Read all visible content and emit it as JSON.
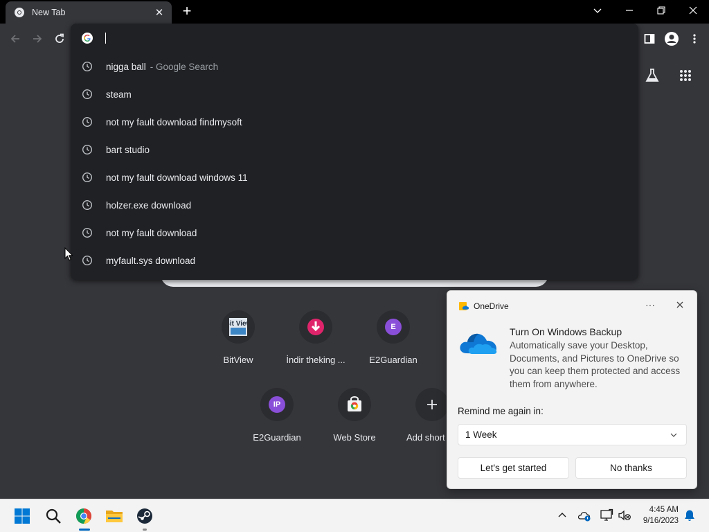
{
  "browser": {
    "tab_title": "New Tab",
    "omnibox_value": "",
    "suggestions": [
      {
        "text": "nigga ball",
        "suffix": "- Google Search"
      },
      {
        "text": "steam",
        "suffix": ""
      },
      {
        "text": "not my fault download findmysoft",
        "suffix": ""
      },
      {
        "text": "bart studio",
        "suffix": ""
      },
      {
        "text": "not my fault download windows 11",
        "suffix": ""
      },
      {
        "text": "holzer.exe download",
        "suffix": ""
      },
      {
        "text": "not my fault download",
        "suffix": ""
      },
      {
        "text": "myfault.sys download",
        "suffix": ""
      }
    ]
  },
  "shortcuts": [
    {
      "label": "BitView",
      "icon": "bitview-logo",
      "icon_text": "Bit View"
    },
    {
      "label": "İndir theking ...",
      "icon": "download-icon"
    },
    {
      "label": "E2Guardian",
      "icon": "letter-avatar",
      "letter": "E"
    },
    {
      "label": "E2Guardian",
      "icon": "letter-avatar",
      "letter": "IP"
    },
    {
      "label": "Web Store",
      "icon": "webstore-icon"
    },
    {
      "label": "Add short",
      "icon": "plus-icon"
    }
  ],
  "onedrive": {
    "app": "OneDrive",
    "title": "Turn On Windows Backup",
    "body": "Automatically save your Desktop, Documents, and Pictures to OneDrive so you can keep them protected and access them from anywhere.",
    "remind_label": "Remind me again in:",
    "remind_value": "1 Week",
    "primary_button": "Let's get started",
    "secondary_button": "No thanks",
    "more": "···"
  },
  "taskbar": {
    "time": "4:45 AM",
    "date": "9/16/2023"
  },
  "colors": {
    "accent": "#0067c0",
    "browser_bg": "#35363a",
    "omnibox_bg": "#202124"
  }
}
